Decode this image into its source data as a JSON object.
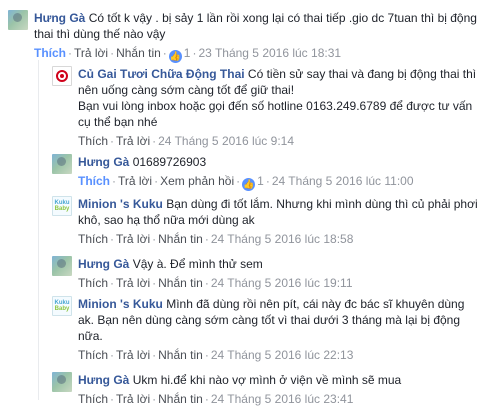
{
  "comments": [
    {
      "author": "Hưng Gà",
      "text": "Có tốt k vậy . bị sảy 1 lần rồi xong lại có thai tiếp .gio dc 7tuan thì bị động thai thì dùng thế nào vậy",
      "actions": {
        "like": "Thích",
        "reply": "Trả lời",
        "message": "Nhắn tin",
        "like_count": "1",
        "timestamp": "23 Tháng 5 2016 lúc 18:31"
      }
    },
    {
      "author": "Củ Gai Tươi Chữa Động Thai",
      "text": "Có tiền sử say thai và đang bị động thai thì nên uống càng sớm càng tốt để giữ thai!",
      "text2": "Bạn vui lòng inbox hoặc gọi đến số hotline 0163.249.6789 để được tư vấn cụ thể bạn nhé",
      "actions": {
        "like": "Thích",
        "reply": "Trả lời",
        "timestamp": "24 Tháng 5 2016 lúc 9:14"
      }
    },
    {
      "author": "Hưng Gà",
      "text": "01689726903",
      "actions": {
        "like": "Thích",
        "reply": "Trả lời",
        "see_reply": "Xem phản hồi",
        "like_count": "1",
        "timestamp": "24 Tháng 5 2016 lúc 11:00"
      }
    },
    {
      "author": "Minion 's Kuku",
      "text": "Bạn dùng đi tốt lắm. Nhưng khi mình dùng thì củ phải phơi khô, sao hạ thổ nữa mới dùng ak",
      "actions": {
        "like": "Thích",
        "reply": "Trả lời",
        "message": "Nhắn tin",
        "timestamp": "24 Tháng 5 2016 lúc 18:58"
      }
    },
    {
      "author": "Hưng Gà",
      "text": "Vậy à. Để mình thử sem",
      "actions": {
        "like": "Thích",
        "reply": "Trả lời",
        "message": "Nhắn tin",
        "timestamp": "24 Tháng 5 2016 lúc 19:11"
      }
    },
    {
      "author": "Minion 's Kuku",
      "text": "Mình đã dùng rồi nên pít, cái này đc bác sĩ khuyên dùng ak. Bạn nên dùng càng sớm càng tốt vì thai dưới 3 tháng mà lại bị động nữa.",
      "actions": {
        "like": "Thích",
        "reply": "Trả lời",
        "message": "Nhắn tin",
        "timestamp": "24 Tháng 5 2016 lúc 22:13"
      }
    },
    {
      "author": "Hưng Gà",
      "text": "Ukm hi.để khi nào vợ mình ở viện về mình sẽ mua",
      "actions": {
        "like": "Thích",
        "reply": "Trả lời",
        "message": "Nhắn tin",
        "timestamp": "24 Tháng 5 2016 lúc 23:41"
      }
    }
  ],
  "kuku_avatar": {
    "line1": "Kuku",
    "line2": "Baby"
  },
  "colors": {
    "name": "#365899",
    "liked": "#5890ff",
    "meta": "#90949c"
  }
}
